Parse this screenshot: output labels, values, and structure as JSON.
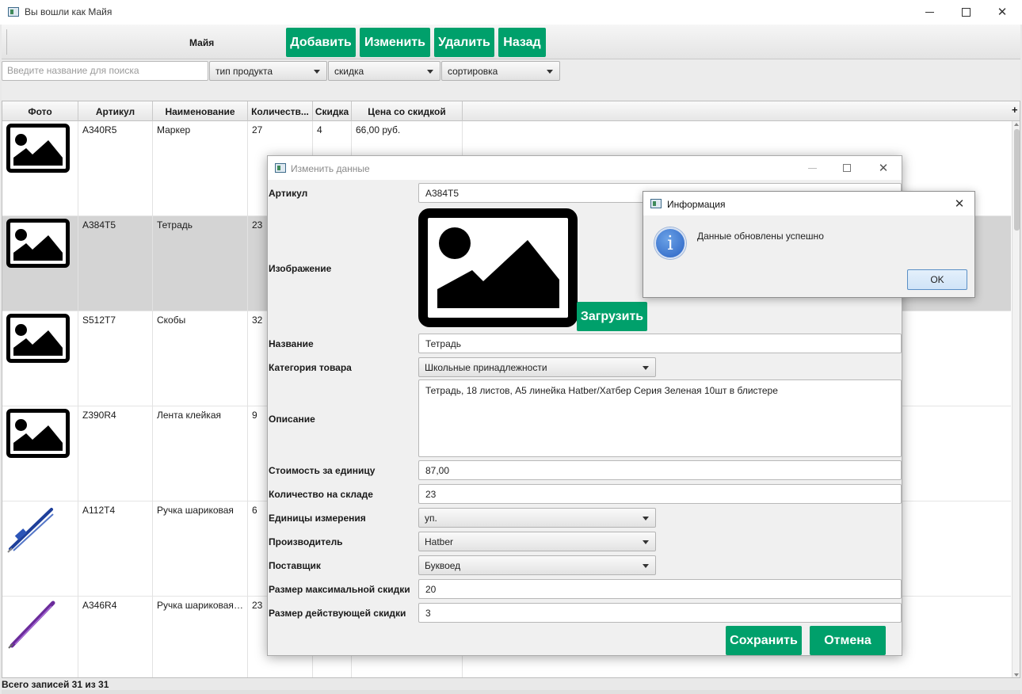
{
  "window": {
    "title": "Вы вошли как Майя"
  },
  "toolbar": {
    "user_name": "Майя",
    "add_label": "Добавить",
    "edit_label": "Изменить",
    "delete_label": "Удалить",
    "back_label": "Назад"
  },
  "filters": {
    "search_placeholder": "Введите название для поиска",
    "product_type": "тип продукта",
    "discount": "скидка",
    "sorting": "сортировка"
  },
  "table": {
    "columns": [
      "Фото",
      "Артикул",
      "Наименование",
      "Количеств...",
      "Скидка",
      "Цена со скидкой"
    ],
    "add_column_symbol": "+",
    "rows": [
      {
        "photo": "placeholder-image-icon",
        "article": "A340R5",
        "name": "Маркер",
        "qty": "27",
        "discount": "4",
        "price": "66,00 руб."
      },
      {
        "photo": "placeholder-image-icon",
        "article": "A384T5",
        "name": "Тетрадь",
        "qty": "23",
        "discount": "",
        "price": ""
      },
      {
        "photo": "placeholder-image-icon",
        "article": "S512T7",
        "name": "Скобы",
        "qty": "32",
        "discount": "",
        "price": ""
      },
      {
        "photo": "placeholder-image-icon",
        "article": "Z390R4",
        "name": "Лента клейкая",
        "qty": "9",
        "discount": "",
        "price": ""
      },
      {
        "photo": "blue-pen-photo",
        "article": "A112T4",
        "name": "Ручка шариковая",
        "qty": "6",
        "discount": "",
        "price": ""
      },
      {
        "photo": "purple-pen-photo",
        "article": "A346R4",
        "name": "Ручка шариковая ...",
        "qty": "23",
        "discount": "",
        "price": ""
      }
    ],
    "selected_row_index": 1
  },
  "footer": {
    "records_text": "Всего записей 31 из 31"
  },
  "edit_dialog": {
    "title": "Изменить данные",
    "labels": {
      "article": "Артикул",
      "image": "Изображение",
      "name": "Название",
      "category": "Категория товара",
      "description": "Описание",
      "unit_cost": "Стоимость за единицу",
      "stock_qty": "Количество на складе",
      "unit": "Единицы измерения",
      "manufacturer": "Производитель",
      "supplier": "Поставщик",
      "max_discount": "Размер максимальной скидки",
      "current_discount": "Размер действующей скидки"
    },
    "values": {
      "article": "A384T5",
      "name": "Тетрадь",
      "category": "Школьные принадлежности",
      "description": "Тетрадь, 18 листов, А5 линейка Hatber/Хатбер Серия Зеленая 10шт в блистере",
      "unit_cost": "87,00",
      "stock_qty": "23",
      "unit": "уп.",
      "manufacturer": "Hatber",
      "supplier": "Буквоед",
      "max_discount": "20",
      "current_discount": "3"
    },
    "upload_label": "Загрузить",
    "save_label": "Сохранить",
    "cancel_label": "Отмена"
  },
  "info_dialog": {
    "title": "Информация",
    "message": "Данные обновлены успешно",
    "ok_label": "OK",
    "icon": "info-icon"
  },
  "colors": {
    "accent_green": "#00a06b",
    "selected_row": "#d4d4d4",
    "info_blue": "#2a63c4"
  }
}
